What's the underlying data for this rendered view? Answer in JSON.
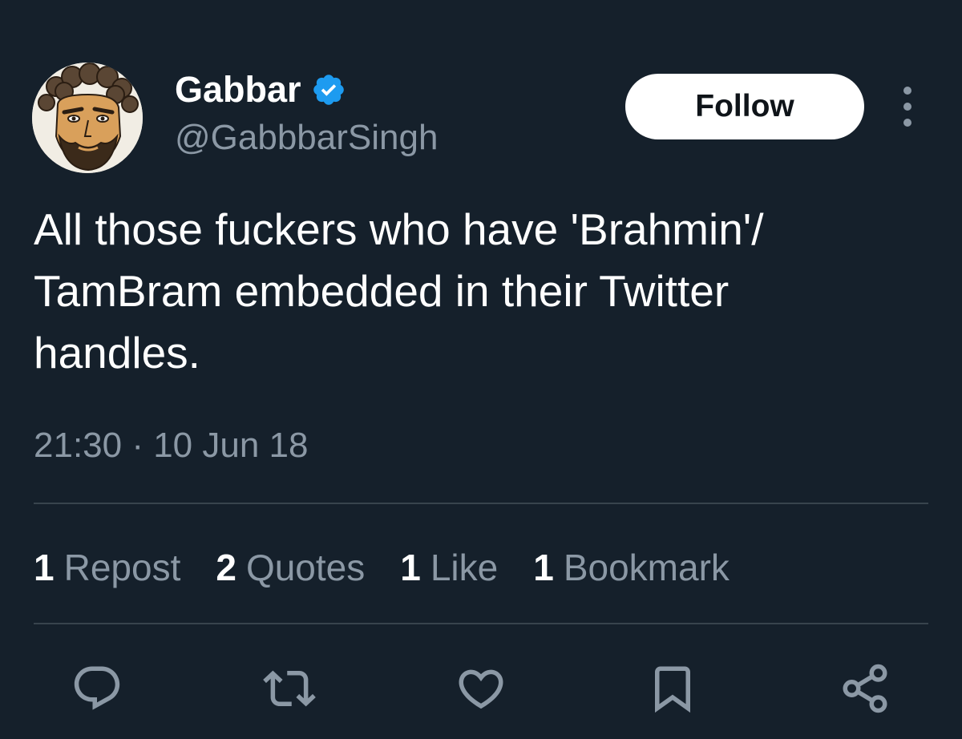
{
  "author": {
    "display_name": "Gabbar",
    "handle": "@GabbbarSingh",
    "verified": true,
    "verified_color": "#1d9bf0"
  },
  "follow_button": {
    "label": "Follow"
  },
  "more_menu": {
    "icon": "more-vertical-icon"
  },
  "tweet": {
    "text_lines": [
      "All those fuckers who have 'Brahmin'/",
      "TamBram embedded in their Twitter",
      "handles."
    ],
    "timestamp": "21:30 · 10 Jun 18"
  },
  "stats": [
    {
      "count": "1",
      "label": "Repost"
    },
    {
      "count": "2",
      "label": "Quotes"
    },
    {
      "count": "1",
      "label": "Like"
    },
    {
      "count": "1",
      "label": "Bookmark"
    }
  ],
  "actions": [
    {
      "name": "reply",
      "icon": "reply-icon"
    },
    {
      "name": "repost",
      "icon": "repost-icon"
    },
    {
      "name": "like",
      "icon": "heart-icon"
    },
    {
      "name": "bookmark",
      "icon": "bookmark-icon"
    },
    {
      "name": "share",
      "icon": "share-icon"
    }
  ],
  "colors": {
    "background": "#15202b",
    "text_primary": "#ffffff",
    "text_secondary": "#8b98a5",
    "divider": "#38444d",
    "follow_bg": "#ffffff",
    "follow_text": "#0f1419"
  }
}
